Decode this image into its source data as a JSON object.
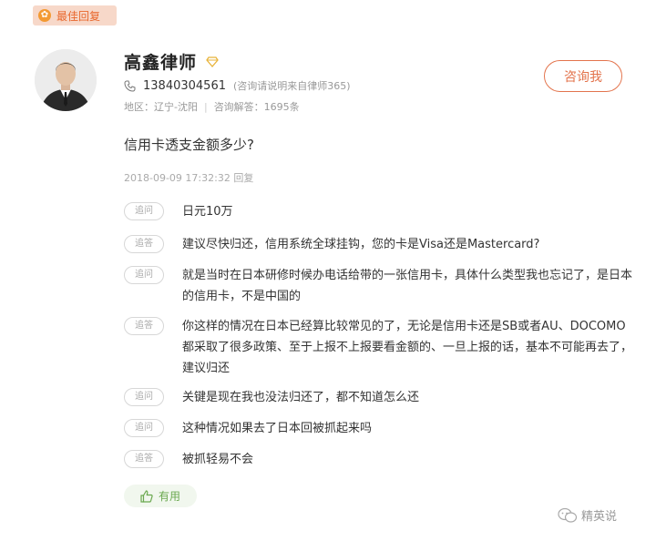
{
  "badge": {
    "label": "最佳回复",
    "icon": "medal-icon"
  },
  "lawyer": {
    "name": "高鑫律师",
    "phone": "13840304561",
    "phone_note": "(咨询请说明来自律师365)",
    "region": "地区：辽宁-沈阳",
    "answers": "咨询解答：1695条"
  },
  "consult_button": "咨询我",
  "question": "信用卡透支金额多少?",
  "timestamp": "2018-09-09 17:32:32 回复",
  "thread": [
    {
      "tag": "追问",
      "text": "日元10万"
    },
    {
      "tag": "追答",
      "text": "建议尽快归还，信用系统全球挂钩，您的卡是Visa还是Mastercard?"
    },
    {
      "tag": "追问",
      "text": "就是当时在日本研修时候办电话给带的一张信用卡，具体什么类型我也忘记了，是日本的信用卡，不是中国的"
    },
    {
      "tag": "追答",
      "text": "你这样的情况在日本已经算比较常见的了，无论是信用卡还是SB或者AU、DOCOMO都采取了很多政策、至于上报不上报要看金额的、一旦上报的话，基本不可能再去了，建议归还"
    },
    {
      "tag": "追问",
      "text": "关键是现在我也没法归还了，都不知道怎么还"
    },
    {
      "tag": "追问",
      "text": "这种情况如果去了日本回被抓起来吗"
    },
    {
      "tag": "追答",
      "text": "被抓轻易不会"
    }
  ],
  "helpful": "有用",
  "watermark": "精英说",
  "colors": {
    "accent": "#e3744d",
    "helpful": "#6aa84f",
    "badge_bg": "#f7d8c9"
  }
}
